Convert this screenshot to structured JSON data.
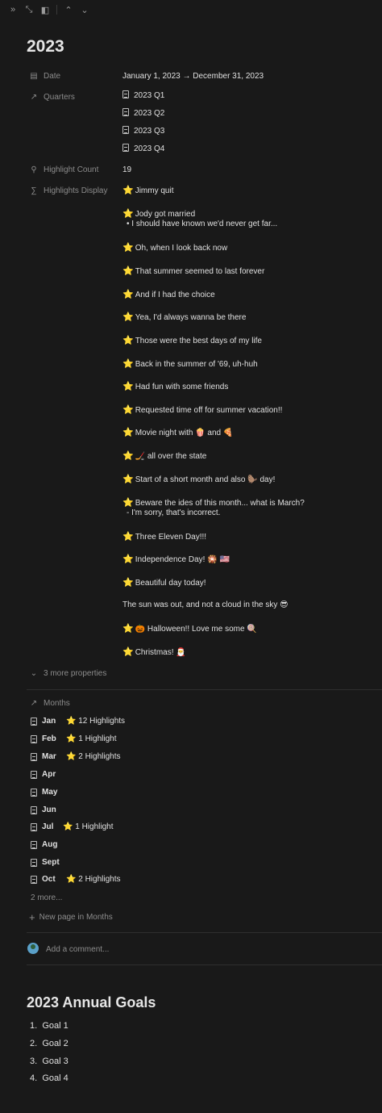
{
  "topbar": {
    "icons": [
      "double-chevron-right-icon",
      "expand-icon",
      "sidebar-icon",
      "chevron-up-icon",
      "chevron-down-icon"
    ]
  },
  "page": {
    "title": "2023"
  },
  "properties": {
    "date": {
      "label": "Date",
      "value": "January 1, 2023 → December 31, 2023"
    },
    "quarters": {
      "label": "Quarters",
      "items": [
        "2023 Q1",
        "2023 Q2",
        "2023 Q3",
        "2023 Q4"
      ]
    },
    "highlight_count": {
      "label": "Highlight Count",
      "value": "19"
    },
    "highlights_display": {
      "label": "Highlights Display",
      "items": [
        {
          "star": "⭐",
          "text": "Jimmy quit"
        },
        {
          "star": "⭐",
          "text": "Jody got married",
          "sub": "• I should have known we'd never get far..."
        },
        {
          "star": "⭐",
          "text": "Oh, when I look back now"
        },
        {
          "star": "⭐",
          "text": "That summer seemed to last forever"
        },
        {
          "star": "⭐",
          "text": "And if I had the choice"
        },
        {
          "star": "⭐",
          "text": "Yea, I'd always wanna be there"
        },
        {
          "star": "⭐",
          "text": "Those were the best days of my life"
        },
        {
          "star": "⭐",
          "text": "Back in the summer of '69, uh-huh"
        },
        {
          "star": "⭐",
          "text": "Had fun with some friends"
        },
        {
          "star": "⭐",
          "text": "Requested time off for summer vacation!!"
        },
        {
          "star": "⭐",
          "text": "Movie night with 🍿 and 🍕"
        },
        {
          "star": "⭐",
          "text": "🏒 all over the state"
        },
        {
          "star": "⭐",
          "text": "Start of a short month and also 🦫 day!"
        },
        {
          "star": "⭐",
          "text": "Beware the ides of this month... what is March?",
          "sub": "- I'm sorry, that's incorrect."
        },
        {
          "star": "⭐",
          "text": "Three Eleven Day!!!"
        },
        {
          "star": "⭐",
          "text": "Independence Day! 🎇 🇺🇸"
        },
        {
          "star": "⭐",
          "text": "Beautiful day today!"
        },
        {
          "star": "",
          "text": "The sun was out, and not a cloud in the sky 😎"
        },
        {
          "star": "⭐",
          "text": "🎃 Halloween!! Love me some 🍭"
        },
        {
          "star": "⭐",
          "text": "Christmas! 🎅"
        }
      ]
    },
    "more_properties": "3 more properties"
  },
  "months": {
    "label": "Months",
    "items": [
      {
        "name": "Jan",
        "badge": "⭐ 12 Highlights"
      },
      {
        "name": "Feb",
        "badge": "⭐ 1 Highlight"
      },
      {
        "name": "Mar",
        "badge": "⭐ 2 Highlights"
      },
      {
        "name": "Apr",
        "badge": ""
      },
      {
        "name": "May",
        "badge": ""
      },
      {
        "name": "Jun",
        "badge": ""
      },
      {
        "name": "Jul",
        "badge": "⭐ 1 Highlight"
      },
      {
        "name": "Aug",
        "badge": ""
      },
      {
        "name": "Sept",
        "badge": ""
      },
      {
        "name": "Oct",
        "badge": "⭐ 2 Highlights"
      }
    ],
    "more": "2 more...",
    "new_page": "New page in Months"
  },
  "comment": {
    "placeholder": "Add a comment..."
  },
  "goals": {
    "title": "2023 Annual Goals",
    "items": [
      {
        "num": "1.",
        "text": "Goal 1"
      },
      {
        "num": "2.",
        "text": "Goal 2"
      },
      {
        "num": "3.",
        "text": "Goal 3"
      },
      {
        "num": "4.",
        "text": "Goal 4"
      }
    ]
  }
}
